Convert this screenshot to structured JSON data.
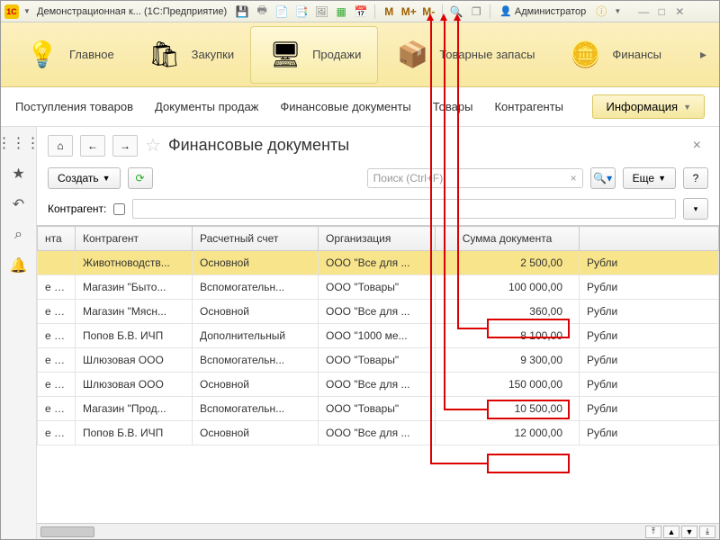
{
  "titlebar": {
    "app_badge": "1C",
    "title": "Демонстрационная к...   (1С:Предприятие)",
    "m_label": "M",
    "mplus_label": "M+",
    "mminus_label": "M-",
    "user_label": "Администратор"
  },
  "sections": [
    {
      "label": "Главное",
      "icon": "💡"
    },
    {
      "label": "Закупки",
      "icon": "🛍"
    },
    {
      "label": "Продажи",
      "icon": "🖥"
    },
    {
      "label": "Товарные запасы",
      "icon": "📦"
    },
    {
      "label": "Финансы",
      "icon": "🪙"
    }
  ],
  "subnav": {
    "items": [
      "Поступления товаров",
      "Документы продаж",
      "Финансовые документы",
      "Товары",
      "Контрагенты"
    ],
    "info_label": "Информация"
  },
  "page": {
    "title": "Финансовые документы",
    "create_label": "Создать",
    "search_placeholder": "Поиск (Ctrl+F)",
    "more_label": "Еще",
    "filter_label": "Контрагент:"
  },
  "table": {
    "headers": [
      "нта",
      "Контрагент",
      "Расчетный счет",
      "Организация",
      "Сумма документа",
      ""
    ],
    "rows": [
      {
        "c0": "",
        "counterparty": "Животноводств...",
        "account": "Основной",
        "org": "ООО \"Все для ...",
        "sum": "2 500,00",
        "cur": "Рубли",
        "sel": true
      },
      {
        "c0": "е д...",
        "counterparty": "Магазин \"Быто...",
        "account": "Вспомогательн...",
        "org": "ООО \"Товары\"",
        "sum": "100 000,00",
        "cur": "Рубли",
        "hl": true
      },
      {
        "c0": "е д...",
        "counterparty": "Магазин \"Мясн...",
        "account": "Основной",
        "org": "ООО \"Все для ...",
        "sum": "360,00",
        "cur": "Рубли"
      },
      {
        "c0": "е д...",
        "counterparty": "Попов Б.В. ИЧП",
        "account": "Дополнительный",
        "org": "ООО \"1000 ме...",
        "sum": "8 100,00",
        "cur": "Рубли"
      },
      {
        "c0": "е д...",
        "counterparty": "Шлюзовая ООО",
        "account": "Вспомогательн...",
        "org": "ООО \"Товары\"",
        "sum": "9 300,00",
        "cur": "Рубли",
        "hl": true
      },
      {
        "c0": "е д...",
        "counterparty": "Шлюзовая ООО",
        "account": "Основной",
        "org": "ООО \"Все для ...",
        "sum": "150 000,00",
        "cur": "Рубли"
      },
      {
        "c0": "е д...",
        "counterparty": "Магазин \"Прод...",
        "account": "Вспомогательн...",
        "org": "ООО \"Товары\"",
        "sum": "10 500,00",
        "cur": "Рубли",
        "hl": true
      },
      {
        "c0": "е д...",
        "counterparty": "Попов Б.В. ИЧП",
        "account": "Основной",
        "org": "ООО \"Все для ...",
        "sum": "12 000,00",
        "cur": "Рубли"
      }
    ]
  }
}
